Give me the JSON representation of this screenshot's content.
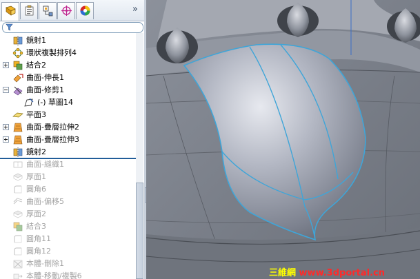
{
  "colors": {
    "rollback_bar": "#215d99",
    "watermark_cn": "#ffff00",
    "watermark_url": "#ff2a2a",
    "edge_highlight": "#3fa5d8"
  },
  "manager_tabs": [
    {
      "icon": "feature-manager-icon",
      "active": true
    },
    {
      "icon": "property-manager-icon",
      "active": false
    },
    {
      "icon": "configuration-manager-icon",
      "active": false
    },
    {
      "icon": "dimxpert-icon",
      "active": false
    },
    {
      "icon": "display-manager-icon",
      "active": false
    }
  ],
  "tabs_more": "»",
  "filter_icon": "funnel-icon",
  "tree": [
    {
      "label": "鏡射1",
      "icon": "mirror-icon",
      "indent": 0,
      "expander": false,
      "dim": false
    },
    {
      "label": "環狀複製排列4",
      "icon": "circular-pattern-icon",
      "indent": 0,
      "expander": false,
      "dim": false
    },
    {
      "label": "結合2",
      "icon": "combine-icon",
      "indent": 0,
      "expander": "plus",
      "dim": false
    },
    {
      "label": "曲面-伸長1",
      "icon": "surface-extend-icon",
      "indent": 0,
      "expander": false,
      "dim": false
    },
    {
      "label": "曲面-修剪1",
      "icon": "surface-trim-icon",
      "indent": 0,
      "expander": "minus",
      "dim": false
    },
    {
      "label": "(-) 草圖14",
      "icon": "sketch-icon",
      "indent": 1,
      "expander": false,
      "dim": false
    },
    {
      "label": "平面3",
      "icon": "plane-icon",
      "indent": 0,
      "expander": false,
      "dim": false
    },
    {
      "label": "曲面-疊層拉伸2",
      "icon": "surface-loft-icon",
      "indent": 0,
      "expander": "plus",
      "dim": false
    },
    {
      "label": "曲面-疊層拉伸3",
      "icon": "surface-loft-icon",
      "indent": 0,
      "expander": "plus",
      "dim": false
    },
    {
      "label": "鏡射2",
      "icon": "mirror-icon",
      "indent": 0,
      "expander": false,
      "dim": false
    },
    {
      "label": "曲面-縫織1",
      "icon": "surface-knit-icon",
      "indent": 0,
      "expander": false,
      "dim": true
    },
    {
      "label": "厚面1",
      "icon": "thicken-icon",
      "indent": 0,
      "expander": false,
      "dim": true
    },
    {
      "label": "圓角6",
      "icon": "fillet-icon",
      "indent": 0,
      "expander": false,
      "dim": true
    },
    {
      "label": "曲面-偏移5",
      "icon": "surface-offset-icon",
      "indent": 0,
      "expander": false,
      "dim": true
    },
    {
      "label": "厚面2",
      "icon": "thicken-icon",
      "indent": 0,
      "expander": false,
      "dim": true
    },
    {
      "label": "結合3",
      "icon": "combine-icon",
      "indent": 0,
      "expander": false,
      "dim": true
    },
    {
      "label": "圓角11",
      "icon": "fillet-icon",
      "indent": 0,
      "expander": false,
      "dim": true
    },
    {
      "label": "圓角12",
      "icon": "fillet-icon",
      "indent": 0,
      "expander": false,
      "dim": true
    },
    {
      "label": "本體-刪除1",
      "icon": "delete-body-icon",
      "indent": 0,
      "expander": false,
      "dim": true
    },
    {
      "label": "本體-移動/複製6",
      "icon": "move-copy-body-icon",
      "indent": 0,
      "expander": false,
      "dim": true
    }
  ],
  "watermark": {
    "cn": "三維網",
    "url": "www.3dportal.cn"
  }
}
